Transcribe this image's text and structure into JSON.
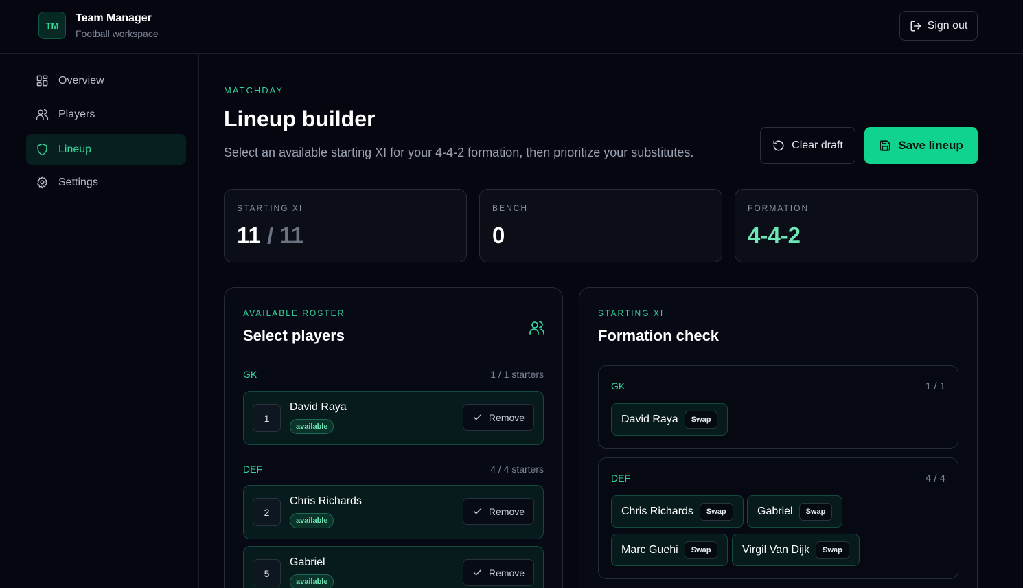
{
  "app": {
    "logo_text": "TM",
    "title": "Team Manager",
    "subtitle": "Football workspace",
    "sign_out_label": "Sign out"
  },
  "nav": {
    "items": [
      {
        "label": "Overview",
        "icon": "grid-icon"
      },
      {
        "label": "Players",
        "icon": "users-icon"
      },
      {
        "label": "Lineup",
        "icon": "shield-icon",
        "active": true
      },
      {
        "label": "Settings",
        "icon": "gear-icon"
      }
    ]
  },
  "page": {
    "eyebrow": "MATCHDAY",
    "title": "Lineup builder",
    "subtitle": "Select an available starting XI for your 4-4-2 formation, then prioritize your substitutes.",
    "clear_label": "Clear draft",
    "save_label": "Save lineup"
  },
  "stats": {
    "starting": {
      "label": "STARTING XI",
      "value": "11",
      "total": "/ 11"
    },
    "bench": {
      "label": "BENCH",
      "value": "0"
    },
    "formation": {
      "label": "FORMATION",
      "value": "4-4-2"
    }
  },
  "roster": {
    "eyebrow": "AVAILABLE ROSTER",
    "title": "Select players",
    "groups": [
      {
        "position": "GK",
        "count": "1 / 1 starters",
        "players": [
          {
            "number": "1",
            "name": "David Raya",
            "status": "available",
            "action": "Remove"
          }
        ]
      },
      {
        "position": "DEF",
        "count": "4 / 4 starters",
        "players": [
          {
            "number": "2",
            "name": "Chris Richards",
            "status": "available",
            "action": "Remove"
          },
          {
            "number": "5",
            "name": "Gabriel",
            "status": "available",
            "action": "Remove"
          }
        ]
      }
    ]
  },
  "formation_check": {
    "eyebrow": "STARTING XI",
    "title": "Formation check",
    "swap_label": "Swap",
    "groups": [
      {
        "position": "GK",
        "count": "1 / 1",
        "players": [
          "David Raya"
        ]
      },
      {
        "position": "DEF",
        "count": "4 / 4",
        "players": [
          "Chris Richards",
          "Gabriel",
          "Marc Guehi",
          "Virgil Van Dijk"
        ]
      }
    ]
  },
  "colors": {
    "accent": "#10d48e",
    "accent_text": "#34d399",
    "background": "#05060f"
  }
}
